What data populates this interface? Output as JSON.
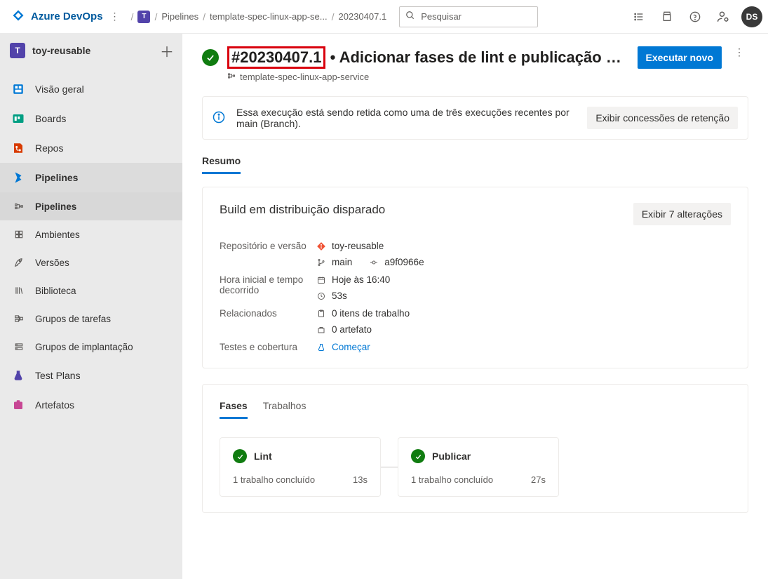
{
  "brand": "Azure DevOps",
  "breadcrumbs": {
    "project_initial": "T",
    "item1": "Pipelines",
    "item2": "template-spec-linux-app-se...",
    "item3": "20230407.1"
  },
  "search": {
    "placeholder": "Pesquisar"
  },
  "avatar": "DS",
  "sidebar": {
    "project_initial": "T",
    "project_name": "toy-reusable",
    "items": [
      {
        "label": "Visão geral"
      },
      {
        "label": "Boards"
      },
      {
        "label": "Repos"
      },
      {
        "label": "Pipelines"
      },
      {
        "label": "Test Plans"
      },
      {
        "label": "Artefatos"
      }
    ],
    "sub_items": [
      {
        "label": "Pipelines"
      },
      {
        "label": "Ambientes"
      },
      {
        "label": "Versões"
      },
      {
        "label": "Biblioteca"
      },
      {
        "label": "Grupos de tarefas"
      },
      {
        "label": "Grupos de implantação"
      }
    ]
  },
  "run": {
    "id": "#20230407.1",
    "title_rest": " • Adicionar fases de lint e publicação ao Serviço de...",
    "pipeline": "template-spec-linux-app-service",
    "run_again": "Executar novo"
  },
  "banner": {
    "text": "Essa execução está sendo retida como uma de três execuções recentes por main (Branch).",
    "button": "Exibir concessões de retenção"
  },
  "tabs": {
    "summary": "Resumo"
  },
  "summary_card": {
    "heading": "Build em distribuição disparado",
    "changes_btn": "Exibir 7 alterações",
    "labels": {
      "repo": "Repositório e versão",
      "time": "Hora inicial e tempo decorrido",
      "related": "Relacionados",
      "tests": "Testes e cobertura"
    },
    "values": {
      "repo_name": "toy-reusable",
      "branch": "main",
      "commit": "a9f0966e",
      "started": "Hoje às 16:40",
      "elapsed": "53s",
      "work_items": "0 itens de trabalho",
      "artifacts": "0 artefato",
      "start_link": "Começar"
    }
  },
  "stages_tabs": {
    "phases": "Fases",
    "jobs": "Trabalhos"
  },
  "stages": [
    {
      "name": "Lint",
      "status_text": "1 trabalho concluído",
      "duration": "13s"
    },
    {
      "name": "Publicar",
      "status_text": "1 trabalho concluído",
      "duration": "27s"
    }
  ]
}
